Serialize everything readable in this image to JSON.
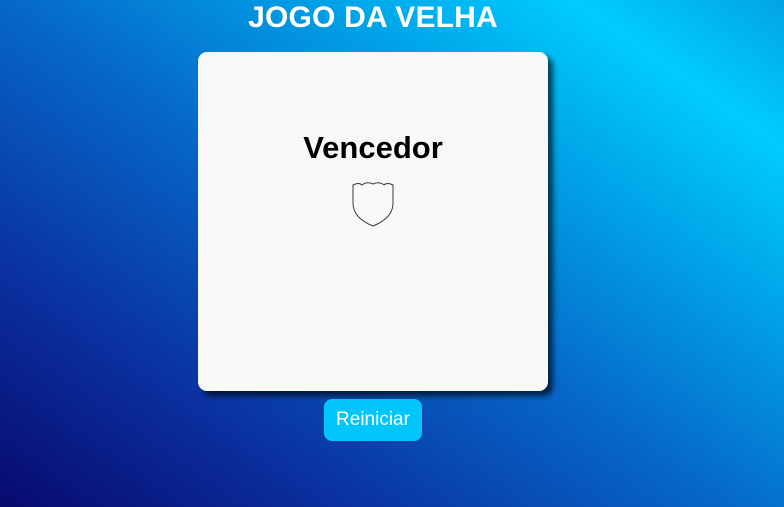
{
  "header": {
    "title": "JOGO DA VELHA"
  },
  "board": {
    "winner_label": "Vencedor",
    "winner_icon": "shield-icon"
  },
  "controls": {
    "restart_label": "Reiniciar"
  },
  "colors": {
    "board_background": "#f8f8f8",
    "button_background": "#00c6fb",
    "title_text": "#ffffff"
  }
}
